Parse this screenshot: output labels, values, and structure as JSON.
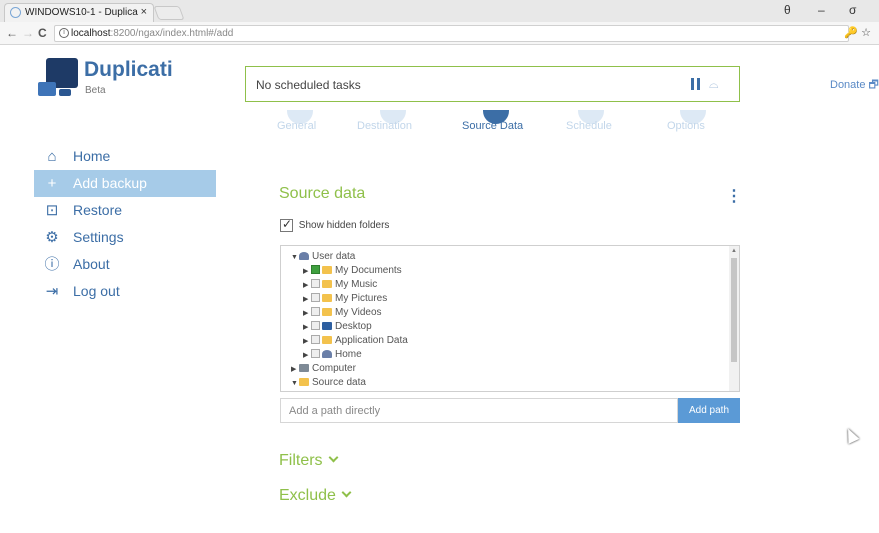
{
  "browser": {
    "tab_title": "WINDOWS10-1 - Duplica",
    "tab_close": "×",
    "url_host": "localhost",
    "url_rest": ":8200/ngax/index.html#/add",
    "window_controls": [
      "θ",
      "–",
      "σ"
    ],
    "back": "←",
    "forward": "→",
    "reload": "C",
    "info": "i",
    "addr_icons": "🔑 ☆"
  },
  "header": {
    "brand": "Duplicati",
    "brand_sub": "Beta",
    "status_text": "No scheduled tasks",
    "throttle_icon": "⌓",
    "donate": "Donate 🗗"
  },
  "steps": [
    {
      "label": "General",
      "active": false
    },
    {
      "label": "Destination",
      "active": false
    },
    {
      "label": "Source Data",
      "active": true
    },
    {
      "label": "Schedule",
      "active": false
    },
    {
      "label": "Options",
      "active": false
    }
  ],
  "sidebar": {
    "items": [
      {
        "label": "Home",
        "icon": "⌂",
        "icon_name": "home-icon"
      },
      {
        "label": "Add backup",
        "icon": "+",
        "icon_name": "plus-icon"
      },
      {
        "label": "Restore",
        "icon": "⊡",
        "icon_name": "restore-icon"
      },
      {
        "label": "Settings",
        "icon": "⚙",
        "icon_name": "gear-icon"
      },
      {
        "label": "About",
        "icon": "ⓘ",
        "icon_name": "info-icon"
      },
      {
        "label": "Log out",
        "icon": "⇥",
        "icon_name": "logout-icon"
      }
    ],
    "active_index": 1
  },
  "source": {
    "title": "Source data",
    "menu_icon": "⋮",
    "show_hidden_label": "Show hidden folders",
    "show_hidden_checked": true,
    "tree": [
      {
        "label": "User data",
        "icon": "user",
        "expanded": true,
        "has_checkbox": false,
        "checked": false
      },
      {
        "label": "My Documents",
        "icon": "folder",
        "expanded": false,
        "has_checkbox": true,
        "checked": true
      },
      {
        "label": "My Music",
        "icon": "folder",
        "expanded": false,
        "has_checkbox": true,
        "checked": false
      },
      {
        "label": "My Pictures",
        "icon": "folder",
        "expanded": false,
        "has_checkbox": true,
        "checked": false
      },
      {
        "label": "My Videos",
        "icon": "folder",
        "expanded": false,
        "has_checkbox": true,
        "checked": false
      },
      {
        "label": "Desktop",
        "icon": "desk",
        "expanded": false,
        "has_checkbox": true,
        "checked": false
      },
      {
        "label": "Application Data",
        "icon": "folder",
        "expanded": false,
        "has_checkbox": true,
        "checked": false
      },
      {
        "label": "Home",
        "icon": "user",
        "expanded": false,
        "has_checkbox": true,
        "checked": false
      },
      {
        "label": "Computer",
        "icon": "comp",
        "expanded": false,
        "has_checkbox": false,
        "checked": false
      },
      {
        "label": "Source data",
        "icon": "folder",
        "expanded": true,
        "has_checkbox": false,
        "checked": false
      }
    ],
    "path_placeholder": "Add a path directly",
    "path_value": "",
    "add_path_label": "Add path"
  },
  "filters_label": "Filters",
  "exclude_label": "Exclude",
  "colors": {
    "accent_blue": "#3c6ea6",
    "accent_green": "#8fc04a",
    "sidebar_active": "#a6cbe8",
    "add_path_button": "#5b9ad6"
  }
}
